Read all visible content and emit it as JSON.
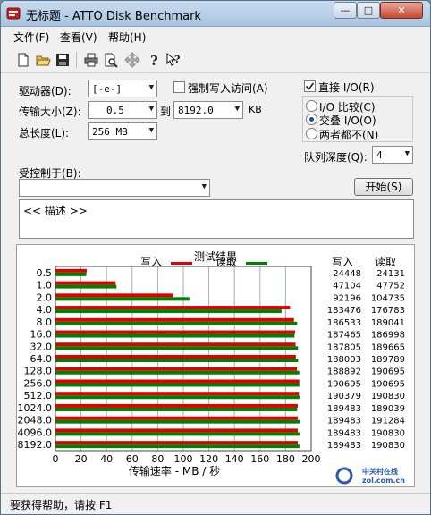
{
  "window": {
    "title": "无标题 - ATTO Disk Benchmark",
    "minimize": "—",
    "maximize": "□",
    "close": "✕"
  },
  "menu": [
    "文件(F)",
    "查看(V)",
    "帮助(H)"
  ],
  "toolbar": [
    "new-icon",
    "open-icon",
    "save-icon",
    "print-icon",
    "print-preview-icon",
    "move-icon",
    "help-icon",
    "context-help-icon"
  ],
  "form": {
    "drive_label": "驱动器(D):",
    "drive_value": "[-e-]",
    "force_write_label": "强制写入访问(A)",
    "transfer_label": "传输大小(Z):",
    "transfer_from": "0.5",
    "to_label": "到",
    "transfer_to": "8192.0",
    "kb_label": "KB",
    "total_label": "总长度(L):",
    "total_value": "256 MB",
    "controlled_label": "受控制于(B):",
    "controlled_value": "",
    "direct_io_label": "直接 I/O(R)",
    "io_compare_label": "I/O 比较(C)",
    "overlapped_io_label": "交叠 I/O(O)",
    "neither_label": "两者都不(N)",
    "queue_label": "队列深度(Q):",
    "queue_value": "4",
    "start_button": "开始(S)",
    "description": "<< 描述 >>"
  },
  "status": "要获得帮助，请按 F1",
  "colors": {
    "write": "#e00000",
    "read": "#008000"
  },
  "chart_data": {
    "type": "bar",
    "title": "测试结果",
    "legend": [
      "写入",
      "读取"
    ],
    "xlabel": "传输速率 - MB / 秒",
    "xlim": [
      0,
      200
    ],
    "xticks": [
      "0",
      "20",
      "40",
      "60",
      "80",
      "100",
      "120",
      "140",
      "160",
      "180",
      "200"
    ],
    "categories": [
      "0.5",
      "1.0",
      "2.0",
      "4.0",
      "8.0",
      "16.0",
      "32.0",
      "64.0",
      "128.0",
      "256.0",
      "512.0",
      "1024.0",
      "2048.0",
      "4096.0",
      "8192.0"
    ],
    "series": [
      {
        "name": "写入",
        "values": [
          24448,
          47104,
          92196,
          183476,
          186533,
          187465,
          187805,
          188003,
          188892,
          190695,
          190379,
          189483,
          189483,
          189483,
          189483
        ]
      },
      {
        "name": "读取",
        "values": [
          24131,
          47752,
          104735,
          176783,
          189041,
          186998,
          189665,
          189789,
          190695,
          190695,
          190830,
          189039,
          191284,
          190830,
          190830
        ]
      }
    ],
    "column_headers": [
      "写入",
      "读取"
    ],
    "grid": true
  },
  "watermark": {
    "brand": "中关村在线",
    "url": "zol.com.cn"
  }
}
